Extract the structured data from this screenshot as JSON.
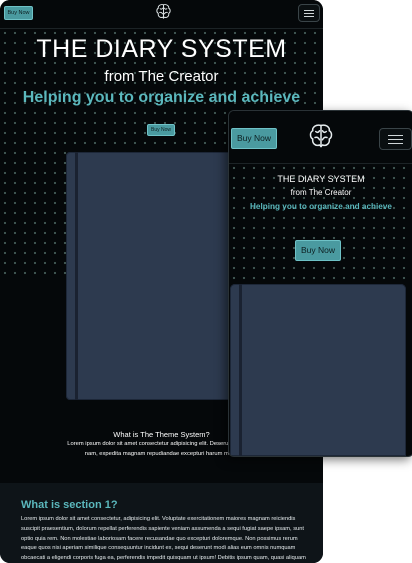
{
  "desktop": {
    "buy_label": "Buy Now",
    "logo_icon": "brain-icon",
    "menu_icon": "hamburger-icon",
    "title": "THE DIARY SYSTEM",
    "subtitle": "from The Creator",
    "tagline": "Helping you to organize and achieve",
    "hero_buy_label": "Buy Now",
    "feature_heading": "What is The Theme System?",
    "feature_text_line1": "Lorem ipsum dolor sit amet consectetur adipisicing elit. Deserunt aperiam",
    "feature_text_line2": "nam, expedita magnam repudiandae excepturi harum modi!",
    "section_heading": "What is section 1?",
    "section_text": "Lorem ipsum dolor sit amet consectetur, adipisicing elit. Voluptate exercitationem maiores magnam reiciendis suscipit praesentium, dolorum repellat perferendis sapiente veniam assumenda a sequi fugiat saepe ipsam, sunt optio quia rem. Non molestiae laboriosam facere recusandae quo excepturi doloremque. Non possimus rerum eaque quos nisi aperiam similique consequuntur incidunt ex, sequi deserunt modi alias eum omnis numquam obcaecati a eligendi corporis fuga ea, perferendis impedit quisquam ut ipsum! Debitis ipsum quam, quasi aliquam obcaecati quia molestiae cum voluptate error."
  },
  "mobile": {
    "buy_label": "Buy Now",
    "logo_icon": "brain-icon",
    "menu_icon": "hamburger-icon",
    "title": "THE DIARY SYSTEM",
    "subtitle": "from The Creator",
    "tagline": "Helping you to organize and achieve",
    "hero_buy_label": "Buy Now"
  },
  "colors": {
    "accent": "#4a9aa0",
    "tagline": "#5bb8bd",
    "background": "#05080a",
    "book": "#2d3a4f"
  }
}
